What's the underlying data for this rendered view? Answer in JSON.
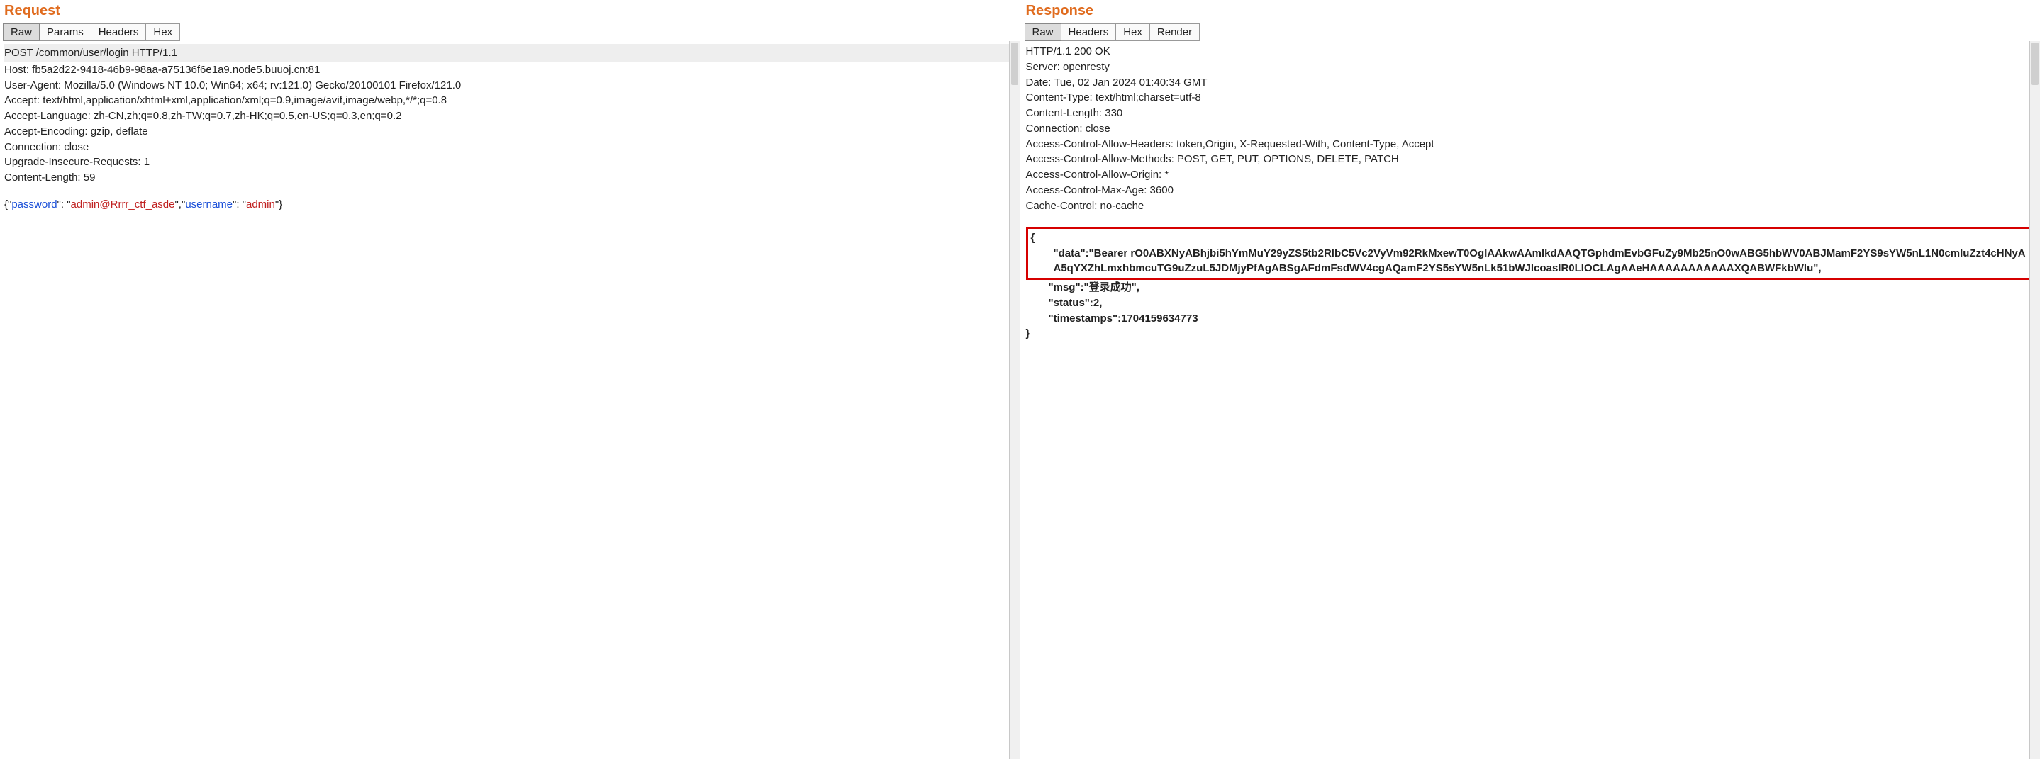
{
  "request": {
    "title": "Request",
    "tabs": {
      "raw": "Raw",
      "params": "Params",
      "headers": "Headers",
      "hex": "Hex"
    },
    "start_line": "POST /common/user/login HTTP/1.1",
    "headers": [
      "Host: fb5a2d22-9418-46b9-98aa-a75136f6e1a9.node5.buuoj.cn:81",
      "User-Agent: Mozilla/5.0 (Windows NT 10.0; Win64; x64; rv:121.0) Gecko/20100101 Firefox/121.0",
      "Accept: text/html,application/xhtml+xml,application/xml;q=0.9,image/avif,image/webp,*/*;q=0.8",
      "Accept-Language: zh-CN,zh;q=0.8,zh-TW;q=0.7,zh-HK;q=0.5,en-US;q=0.3,en;q=0.2",
      "Accept-Encoding: gzip, deflate",
      "Connection: close",
      "Upgrade-Insecure-Requests: 1",
      "Content-Length: 59"
    ],
    "body": {
      "open": "{\"",
      "k1": "password",
      "mid1": "\": \"",
      "v1": "admin@Rrrr_ctf_asde",
      "sep": "\",\"",
      "k2": "username",
      "mid2": "\": \"",
      "v2": "admin",
      "close": "\"}"
    }
  },
  "response": {
    "title": "Response",
    "tabs": {
      "raw": "Raw",
      "headers": "Headers",
      "hex": "Hex",
      "render": "Render"
    },
    "start_line": "HTTP/1.1 200 OK",
    "headers": [
      "Server: openresty",
      "Date: Tue, 02 Jan 2024 01:40:34 GMT",
      "Content-Type: text/html;charset=utf-8",
      "Content-Length: 330",
      "Connection: close",
      "Access-Control-Allow-Headers: token,Origin, X-Requested-With, Content-Type, Accept",
      "Access-Control-Allow-Methods: POST, GET, PUT, OPTIONS, DELETE, PATCH",
      "Access-Control-Allow-Origin: *",
      "Access-Control-Max-Age: 3600",
      "Cache-Control: no-cache"
    ],
    "body_box": {
      "open": "{",
      "data_line": "\"data\":\"Bearer rO0ABXNyABhjbi5hYmMuY29yZS5tb2RlbC5Vc2VyVm92RkMxewT0OgIAAkwAAmlkdAAQTGphdmEvbGFuZy9Mb25nO0wABG5hbWV0ABJMamF2YS9sYW5nL1N0cmluZzt4cHNyAA5qYXZhLmxhbmcuTG9uZzuL5JDMjyPfAgABSgAFdmFsdWV4cgAQamF2YS5sYW5nLk51bWJlcoasIR0LIOCLAgAAeHAAAAAAAAAAAXQABWFkbWlu\","
    },
    "body_after": {
      "msg": "\"msg\":\"登录成功\",",
      "status": "\"status\":2,",
      "timestamps": "\"timestamps\":1704159634773",
      "close": "}"
    }
  }
}
